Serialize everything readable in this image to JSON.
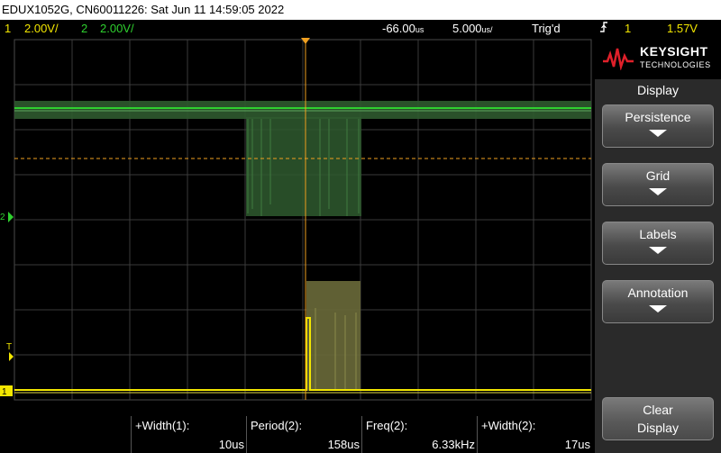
{
  "title_bar": {
    "text": "EDUX1052G, CN60011226: Sat Jun 11 14:59:05 2022"
  },
  "status_bar": {
    "ch1_num": "1",
    "ch1_scale": "2.00V/",
    "ch2_num": "2",
    "ch2_scale": "2.00V/",
    "delay": "-66.00",
    "delay_unit": "us",
    "timebase": "5.000",
    "timebase_unit": "us/",
    "trigger_state": "Trig'd",
    "trigger_channel": "1",
    "trigger_level": "1.57V"
  },
  "markers": {
    "ch2_marker": "2",
    "trigger_marker": "T",
    "ch1_marker": "1"
  },
  "colors": {
    "ch1": "#f2e600",
    "ch2": "#2fd02f",
    "trigger": "#f0a020",
    "grid": "#3a3a3a"
  },
  "measurements": [
    {
      "label": "+Width(1):",
      "value": "10us"
    },
    {
      "label": "Period(2):",
      "value": "158us"
    },
    {
      "label": "Freq(2):",
      "value": "6.33kHz"
    },
    {
      "label": "+Width(2):",
      "value": "17us"
    }
  ],
  "panel": {
    "brand_name": "KEYSIGHT",
    "brand_sub": "TECHNOLOGIES",
    "menu_title": "Display",
    "softkeys": [
      {
        "label": "Persistence"
      },
      {
        "label": "Grid"
      },
      {
        "label": "Labels"
      },
      {
        "label": "Annotation"
      }
    ],
    "clear_line1": "Clear",
    "clear_line2": "Display"
  }
}
